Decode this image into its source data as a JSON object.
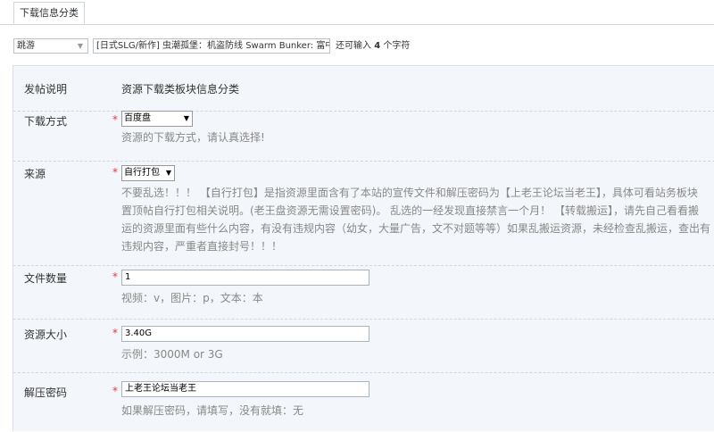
{
  "tab": {
    "label": "下载信息分类"
  },
  "title_row": {
    "type_value": "跳游",
    "subject_value": "[日式SLG/新作] 虫潮孤堡：机盗防线 Swarm Bunker: 富中",
    "remain_prefix": "还可输入 ",
    "remain_count": "4",
    "remain_suffix": " 个字符"
  },
  "form": {
    "post_note": {
      "label": "发帖说明",
      "value": "资源下载类板块信息分类"
    },
    "download_method": {
      "label": "下载方式",
      "required": "*",
      "value": "百度盘",
      "tip": "资源的下载方式，请认真选择!"
    },
    "source": {
      "label": "来源",
      "required": "*",
      "value": "自行打包",
      "tip_lines": [
        "不要乱选！！！ 【自行打包】是指资源里面含有了本站的宣传文件和解压密码为【上老王论坛当老王】，具体可看站务板块",
        "置顶帖自行打包相关说明。(老王盘资源无需设置密码)。 乱选的一经发现直接禁言一个月！ 【转载搬运】，请先自己看看搬",
        "运的资源里面有些什么内容，有没有违规内容（幼女，大量广告，文不对题等等）如果乱搬运资源，未经检查乱搬运，查出有",
        "违规内容，严重者直接封号！！！"
      ]
    },
    "file_count": {
      "label": "文件数量",
      "required": "*",
      "value": "1",
      "tip": "视频：v，图片：p，文本：本"
    },
    "resource_size": {
      "label": "资源大小",
      "required": "*",
      "value": "3.40G",
      "tip": "示例：3000M or 3G"
    },
    "unzip_password": {
      "label": "解压密码",
      "required": "*",
      "value": "上老王论坛当老王",
      "tip": "如果解压密码，请填写，没有就填：无"
    }
  },
  "icons": {
    "dropdown": "chevron-down-icon"
  },
  "colors": {
    "required": "#ee3333",
    "form_bg": "#f3f6fa",
    "tip": "#888888"
  }
}
